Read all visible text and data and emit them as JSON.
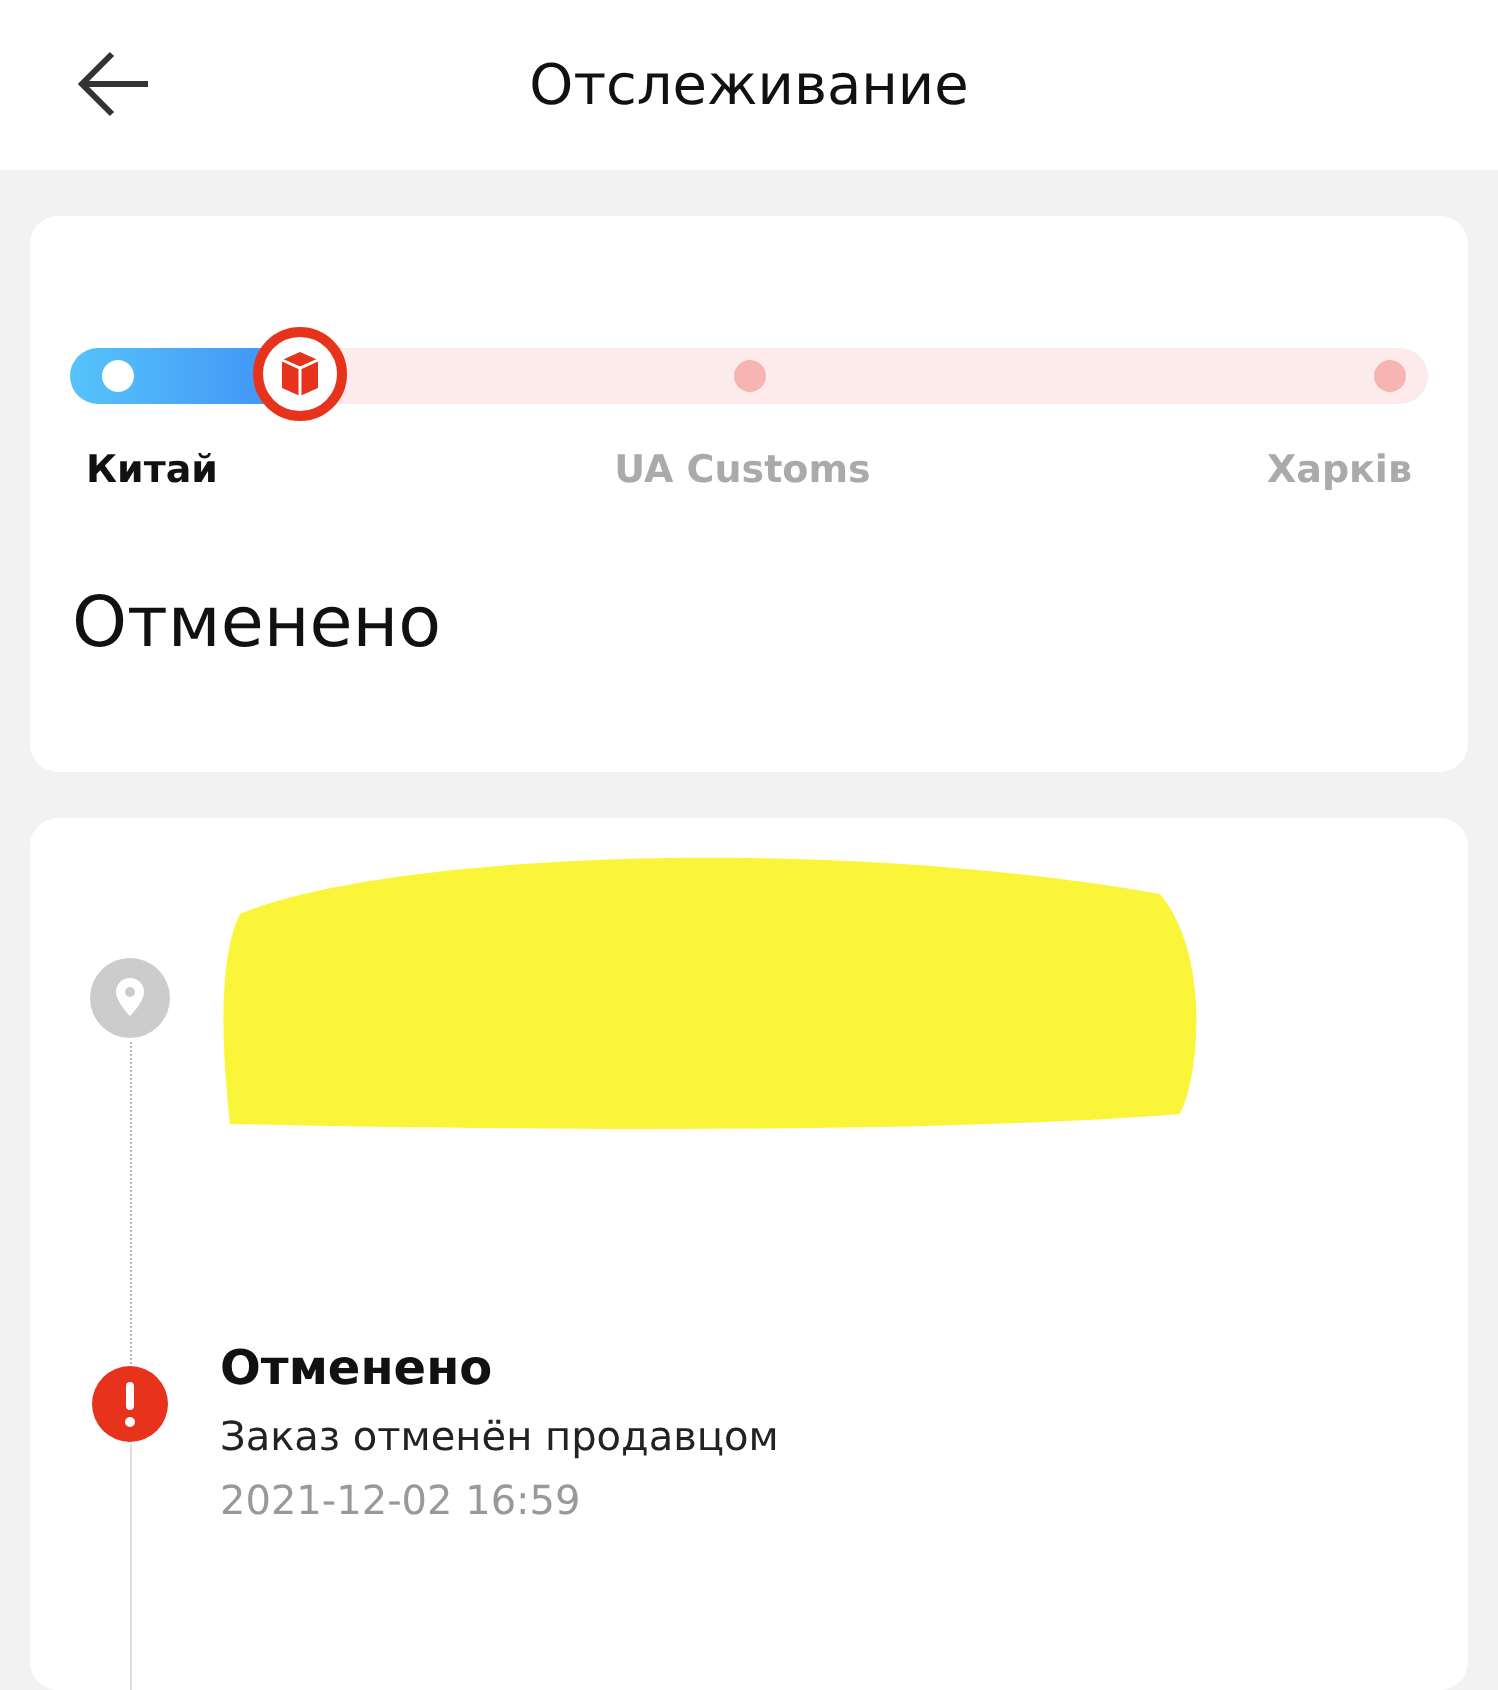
{
  "header": {
    "title": "Отслеживание"
  },
  "progress": {
    "level": 0.17,
    "stages": [
      {
        "label": "Китай",
        "current": true
      },
      {
        "label": "UA Customs",
        "current": false
      },
      {
        "label": "Харків",
        "current": false
      }
    ]
  },
  "status": "Отменено",
  "events": [
    {
      "kind": "location",
      "redacted": true
    },
    {
      "kind": "alert",
      "title": "Отменено",
      "description": "Заказ отменён продавцом",
      "time": "2021-12-02 16:59"
    }
  ]
}
